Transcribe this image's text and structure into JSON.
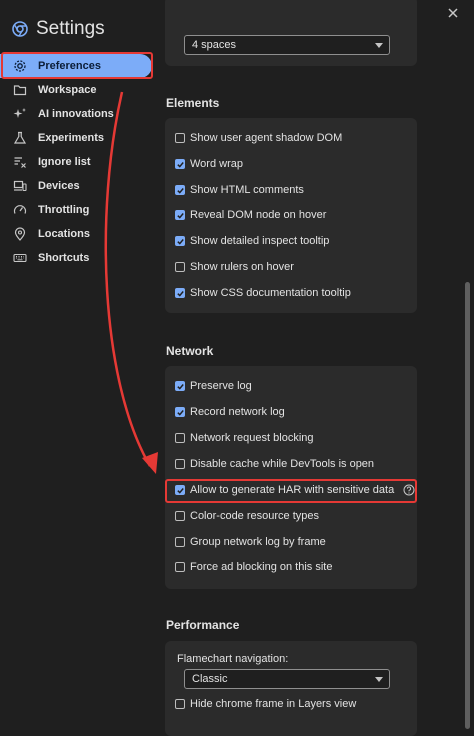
{
  "header": {
    "title": "Settings"
  },
  "sidebar": {
    "items": [
      {
        "label": "Preferences",
        "icon": "gear-icon",
        "selected": true
      },
      {
        "label": "Workspace",
        "icon": "folder-icon"
      },
      {
        "label": "AI innovations",
        "icon": "sparkle-icon"
      },
      {
        "label": "Experiments",
        "icon": "flask-icon"
      },
      {
        "label": "Ignore list",
        "icon": "list-filter-icon"
      },
      {
        "label": "Devices",
        "icon": "devices-icon"
      },
      {
        "label": "Throttling",
        "icon": "speedometer-icon"
      },
      {
        "label": "Locations",
        "icon": "location-pin-icon"
      },
      {
        "label": "Shortcuts",
        "icon": "keyboard-icon"
      }
    ]
  },
  "indent": {
    "value": "4 spaces"
  },
  "elements": {
    "title": "Elements",
    "options": [
      {
        "label": "Show user agent shadow DOM",
        "checked": false
      },
      {
        "label": "Word wrap",
        "checked": true
      },
      {
        "label": "Show HTML comments",
        "checked": true
      },
      {
        "label": "Reveal DOM node on hover",
        "checked": true
      },
      {
        "label": "Show detailed inspect tooltip",
        "checked": true
      },
      {
        "label": "Show rulers on hover",
        "checked": false
      },
      {
        "label": "Show CSS documentation tooltip",
        "checked": true
      }
    ]
  },
  "network": {
    "title": "Network",
    "options": [
      {
        "label": "Preserve log",
        "checked": true
      },
      {
        "label": "Record network log",
        "checked": true
      },
      {
        "label": "Network request blocking",
        "checked": false
      },
      {
        "label": "Disable cache while DevTools is open",
        "checked": false
      },
      {
        "label": "Allow to generate HAR with sensitive data",
        "checked": true
      },
      {
        "label": "Color-code resource types",
        "checked": false
      },
      {
        "label": "Group network log by frame",
        "checked": false
      },
      {
        "label": "Force ad blocking on this site",
        "checked": false
      }
    ]
  },
  "performance": {
    "title": "Performance",
    "flamechart_label": "Flamechart navigation:",
    "flamechart_value": "Classic",
    "options": [
      {
        "label": "Hide chrome frame in Layers view",
        "checked": false
      }
    ]
  },
  "colors": {
    "accent": "#7cacf8",
    "highlight": "#e53935",
    "background": "#1f1f1f",
    "card": "#2b2b2b"
  }
}
